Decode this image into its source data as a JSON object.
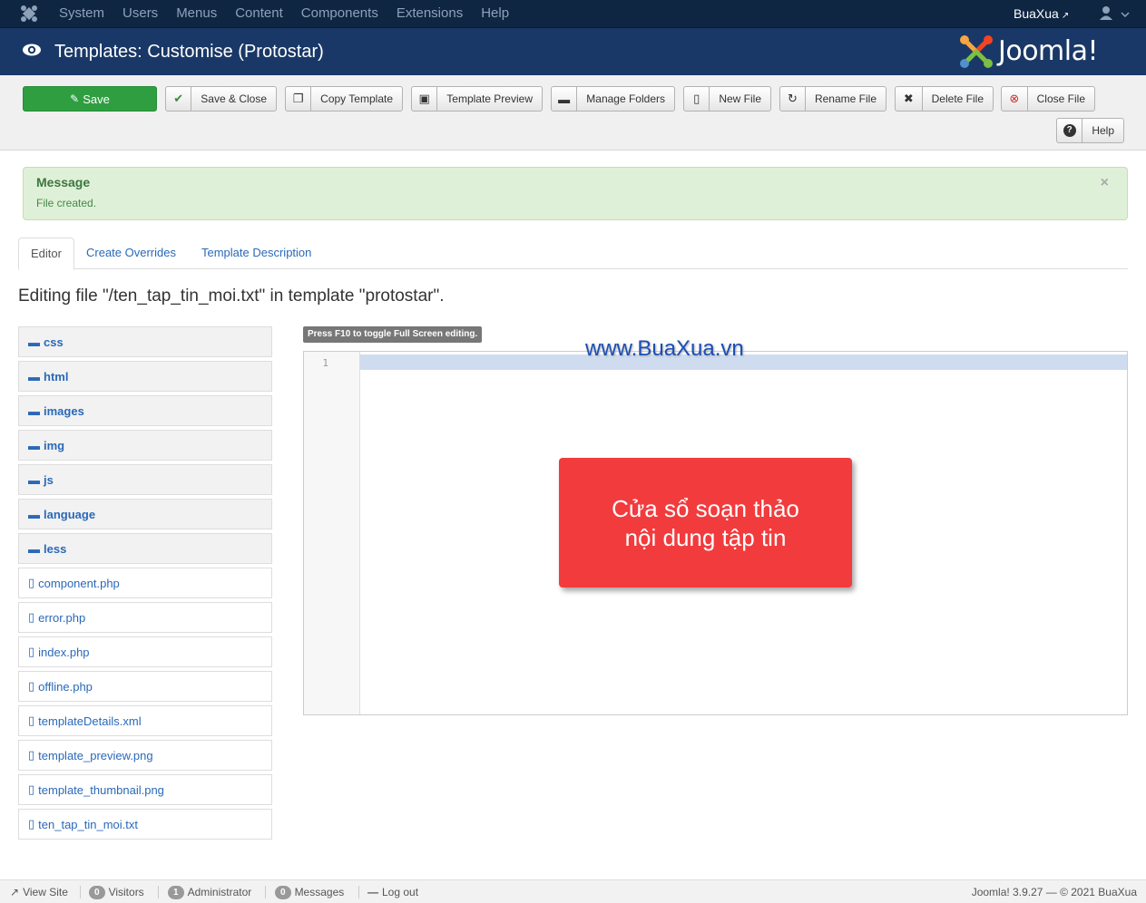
{
  "topnav": {
    "menu": [
      "System",
      "Users",
      "Menus",
      "Content",
      "Components",
      "Extensions",
      "Help"
    ],
    "site_name": "BuaXua"
  },
  "header": {
    "title": "Templates: Customise (Protostar)",
    "brand": "Joomla!"
  },
  "toolbar": {
    "save": "Save",
    "save_close": "Save & Close",
    "copy_template": "Copy Template",
    "template_preview": "Template Preview",
    "manage_folders": "Manage Folders",
    "new_file": "New File",
    "rename_file": "Rename File",
    "delete_file": "Delete File",
    "close_file": "Close File",
    "help": "Help"
  },
  "message": {
    "heading": "Message",
    "text": "File created."
  },
  "tabs": [
    "Editor",
    "Create Overrides",
    "Template Description"
  ],
  "editing_heading": "Editing file \"/ten_tap_tin_moi.txt\" in template \"protostar\".",
  "tree": {
    "folders": [
      "css",
      "html",
      "images",
      "img",
      "js",
      "language",
      "less"
    ],
    "files": [
      "component.php",
      "error.php",
      "index.php",
      "offline.php",
      "templateDetails.xml",
      "template_preview.png",
      "template_thumbnail.png",
      "ten_tap_tin_moi.txt"
    ]
  },
  "editor": {
    "hint": "Press F10 to toggle Full Screen editing.",
    "line_number": "1"
  },
  "watermark": "www.BuaXua.vn",
  "callout": {
    "line1": "Cửa sổ soạn thảo",
    "line2": "nội dung tập tin"
  },
  "statusbar": {
    "view_site": "View Site",
    "visitors_count": "0",
    "visitors": "Visitors",
    "admin_count": "1",
    "administrator": "Administrator",
    "messages_count": "0",
    "messages": "Messages",
    "logout": "Log out",
    "version": "Joomla! 3.9.27 — © 2021 BuaXua"
  },
  "colors": {
    "navbar": "#0f2643",
    "header": "#1a3867",
    "save_button": "#2f9e41",
    "callout": "#f23b3d",
    "link": "#2a69b8"
  }
}
